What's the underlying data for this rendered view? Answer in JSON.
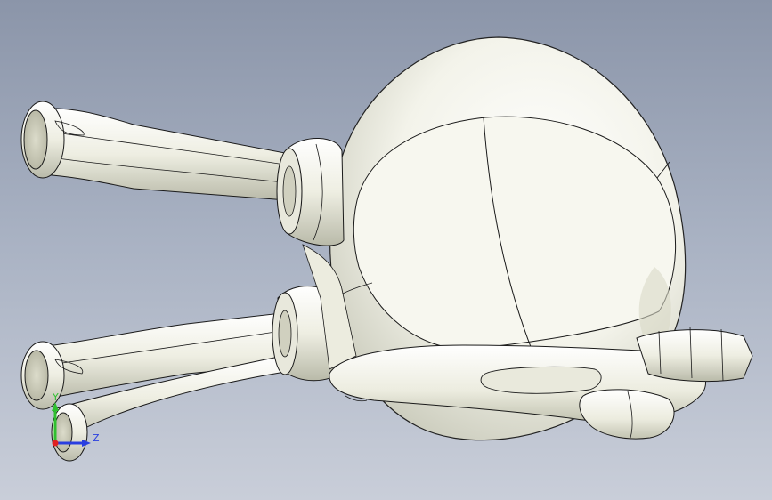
{
  "viewport": {
    "background_top": "#8b95a9",
    "background_bottom": "#c9ced9",
    "model_color": "#f1f1e6",
    "edge_color": "#1a1a1a"
  },
  "triad": {
    "y_label": "Y",
    "z_label": "Z",
    "y_color": "#2fbf2f",
    "z_color": "#2a3fe0",
    "x_color": "#e02020"
  }
}
